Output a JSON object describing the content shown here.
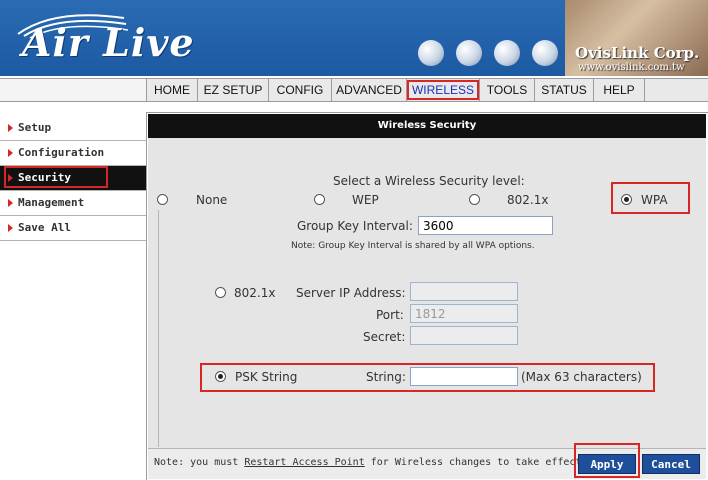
{
  "header": {
    "logo": "Air Live",
    "brand": "OvisLink Corp.",
    "brand_url": "www.ovislink.com.tw"
  },
  "nav": {
    "tabs": [
      "HOME",
      "EZ SETUP",
      "CONFIG",
      "ADVANCED",
      "WIRELESS",
      "TOOLS",
      "STATUS",
      "HELP"
    ],
    "active": "WIRELESS"
  },
  "sidebar": {
    "items": [
      {
        "label": "Setup"
      },
      {
        "label": "Configuration"
      },
      {
        "label": "Security"
      },
      {
        "label": "Management"
      },
      {
        "label": "Save All"
      }
    ],
    "active": "Security"
  },
  "page": {
    "title": "Wireless Security",
    "level_prompt": "Select a Wireless Security level:",
    "levels": [
      "None",
      "WEP",
      "802.1x",
      "WPA"
    ],
    "selected_level": "WPA",
    "group_key_label": "Group Key Interval:",
    "group_key_value": "3600",
    "note": "Note: Group Key Interval is shared by all WPA options.",
    "radius_option": "802.1x",
    "server_ip_label": "Server IP Address:",
    "server_ip_value": "",
    "port_label": "Port:",
    "port_value": "1812",
    "secret_label": "Secret:",
    "secret_value": "",
    "psk_option": "PSK String",
    "psk_label": "String:",
    "psk_value": "",
    "psk_hint": "(Max 63 characters)"
  },
  "footer": {
    "note_prefix": "Note: you must ",
    "note_link": "Restart Access Point",
    "note_suffix": " for Wireless changes to take effect.",
    "apply": "Apply",
    "cancel": "Cancel"
  },
  "colors": {
    "header_blue": "#2a6bb4",
    "highlight_red": "#d62626",
    "button_blue": "#1f4f9a",
    "title_bar": "#111111"
  }
}
